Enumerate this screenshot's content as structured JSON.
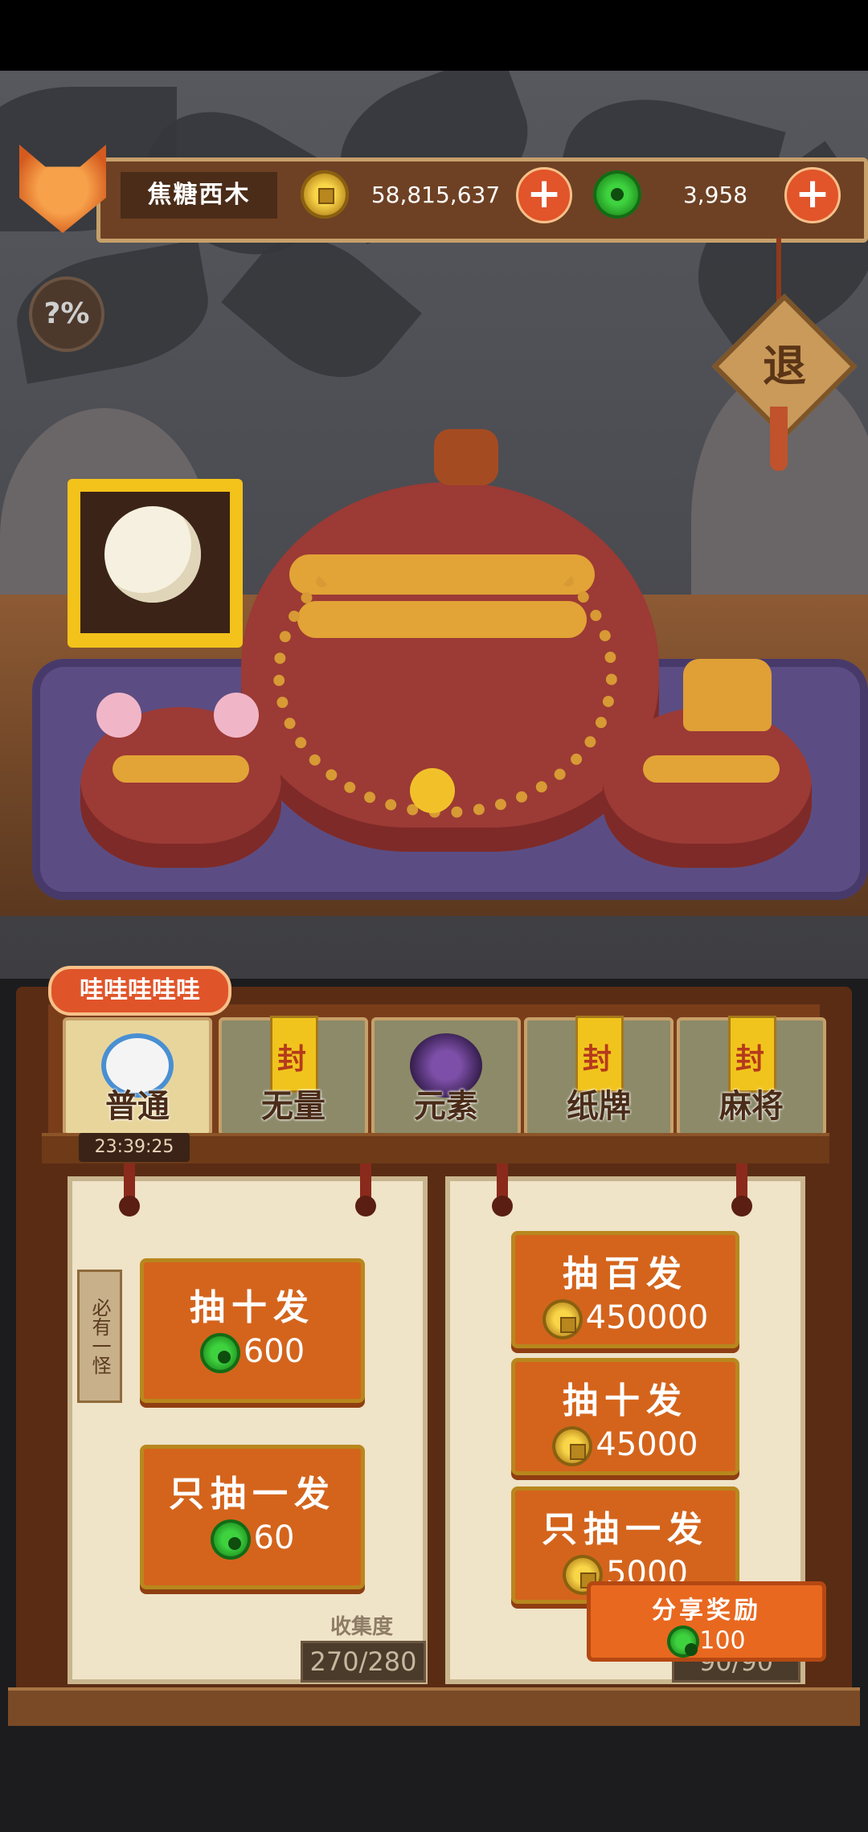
{
  "player": {
    "name": "焦糖西木"
  },
  "currency": {
    "gold": {
      "icon": "gold-coin-icon",
      "value": "58,815,637"
    },
    "jade": {
      "icon": "jade-coin-icon",
      "value": "3,958"
    }
  },
  "help_label": "?%",
  "exit_label": "退",
  "tabs": [
    {
      "label": "普通",
      "icon": "mouse-pet-icon",
      "active": true
    },
    {
      "label": "无量",
      "icon": "seal-icon",
      "active": false
    },
    {
      "label": "元素",
      "icon": "seal-icon",
      "active": false
    },
    {
      "label": "纸牌",
      "icon": "seal-icon",
      "active": false
    },
    {
      "label": "麻将",
      "icon": "seal-icon",
      "active": false
    }
  ],
  "bubble_text": "哇哇哇哇哇",
  "timer": "23:39:25",
  "sign_text": "必有一怪",
  "left_pool": {
    "buttons": [
      {
        "title": "抽十发",
        "price": "600",
        "currency": "jade"
      },
      {
        "title": "只抽一发",
        "price": "60",
        "currency": "jade"
      }
    ],
    "collection_label": "收集度",
    "collection_value": "270/280"
  },
  "right_pool": {
    "buttons": [
      {
        "title": "抽百发",
        "price": "450000",
        "currency": "gold"
      },
      {
        "title": "抽十发",
        "price": "45000",
        "currency": "gold"
      },
      {
        "title": "只抽一发",
        "price": "5000",
        "currency": "gold"
      }
    ],
    "collection_value": "90/90"
  },
  "share": {
    "title": "分享奖励",
    "reward": "100",
    "currency": "jade"
  }
}
